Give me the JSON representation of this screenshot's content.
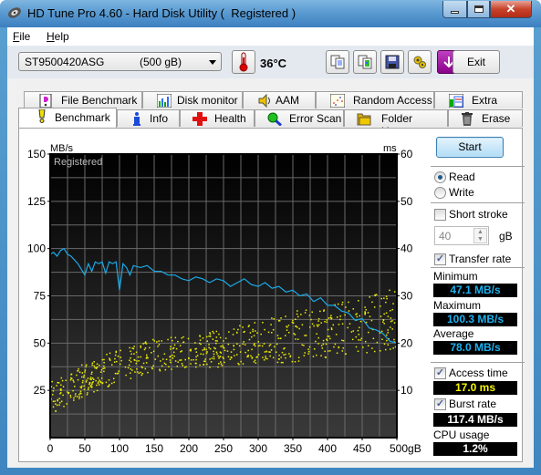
{
  "window": {
    "title": "HD Tune Pro 4.60 - Hard Disk Utility (  Registered )",
    "controls": {
      "minimize": "minimize",
      "maximize": "maximize",
      "close": "close"
    }
  },
  "menu": [
    {
      "label": "File",
      "accel": "F"
    },
    {
      "label": "Help",
      "accel": "H"
    }
  ],
  "toolbar": {
    "drive": {
      "name": "ST9500420ASG",
      "size": "(500 gB)"
    },
    "temperature": "36°C",
    "icons": [
      "thermometer-icon",
      "copy-text-icon",
      "copy-image-icon",
      "save-icon",
      "options-icon",
      "download-icon"
    ],
    "exit_label": "Exit"
  },
  "tabs": {
    "top_row": [
      {
        "label": "File Benchmark",
        "icon": "file-benchmark-icon"
      },
      {
        "label": "Disk monitor",
        "icon": "disk-monitor-icon"
      },
      {
        "label": "AAM",
        "icon": "speaker-icon"
      },
      {
        "label": "Random Access",
        "icon": "random-access-icon"
      },
      {
        "label": "Extra tests",
        "icon": "extra-tests-icon"
      }
    ],
    "bottom_row": [
      {
        "label": "Benchmark",
        "icon": "benchmark-icon",
        "active": true
      },
      {
        "label": "Info",
        "icon": "info-icon"
      },
      {
        "label": "Health",
        "icon": "health-icon"
      },
      {
        "label": "Error Scan",
        "icon": "error-scan-icon"
      },
      {
        "label": "Folder Usage",
        "icon": "folder-icon"
      },
      {
        "label": "Erase",
        "icon": "trash-icon"
      }
    ]
  },
  "controls": {
    "start_label": "Start",
    "read_label": "Read",
    "write_label": "Write",
    "mode_selected": "Read",
    "short_stroke_label": "Short stroke",
    "short_stroke_checked": false,
    "short_stroke_value": "40",
    "short_stroke_unit": "gB",
    "transfer_rate_label": "Transfer rate",
    "transfer_rate_checked": true,
    "access_time_label": "Access time",
    "access_time_checked": true,
    "burst_rate_label": "Burst rate",
    "burst_rate_checked": true
  },
  "results": {
    "minimum_label": "Minimum",
    "minimum": "47.1 MB/s",
    "maximum_label": "Maximum",
    "maximum": "100.3 MB/s",
    "average_label": "Average",
    "average": "78.0 MB/s",
    "access_time": "17.0 ms",
    "burst_rate": "117.4 MB/s",
    "cpu_usage_label": "CPU usage",
    "cpu_usage": "1.2%"
  },
  "colors": {
    "transfer_line": "#1aa9e8",
    "access_points": "#f0f000",
    "plot_bg_top": "#000000",
    "plot_bg_bottom": "#3a3a3a",
    "grid": "#6a6a6a",
    "readout_cyan": "#1ab2f0",
    "readout_yellow": "#f5f500"
  },
  "chart_data": {
    "type": "line",
    "watermark": "Registered",
    "xlabel": "gB",
    "ylabel_left": "MB/s",
    "ylabel_right": "ms",
    "xlim": [
      0,
      500
    ],
    "ylim_left": [
      0,
      150
    ],
    "ylim_right": [
      0,
      60
    ],
    "x_ticks": [
      "0",
      "50",
      "100",
      "150",
      "200",
      "250",
      "300",
      "350",
      "400",
      "450",
      "500gB"
    ],
    "y_left_ticks": [
      "25",
      "50",
      "75",
      "100",
      "125",
      "150"
    ],
    "y_right_ticks": [
      "10",
      "20",
      "30",
      "40",
      "50",
      "60"
    ],
    "grid": true,
    "series": [
      {
        "name": "Transfer rate",
        "axis": "left",
        "unit": "MB/s",
        "x": [
          0,
          5,
          10,
          15,
          20,
          25,
          30,
          40,
          50,
          55,
          60,
          65,
          70,
          75,
          80,
          85,
          90,
          95,
          100,
          105,
          110,
          115,
          120,
          130,
          140,
          150,
          160,
          170,
          180,
          190,
          200,
          210,
          220,
          230,
          240,
          250,
          260,
          270,
          280,
          290,
          300,
          310,
          320,
          330,
          340,
          350,
          360,
          370,
          380,
          390,
          400,
          410,
          420,
          430,
          440,
          450,
          460,
          470,
          480,
          490,
          500
        ],
        "values": [
          97,
          98,
          96,
          99,
          100,
          97,
          96,
          92,
          86,
          92,
          88,
          93,
          92,
          93,
          87,
          93,
          92,
          93,
          78,
          92,
          90,
          86,
          91,
          90,
          91,
          88,
          88,
          86,
          86,
          84,
          83,
          85,
          84,
          82,
          84,
          83,
          80,
          82,
          84,
          81,
          80,
          82,
          79,
          80,
          77,
          78,
          75,
          76,
          72,
          74,
          70,
          70,
          67,
          66,
          62,
          63,
          58,
          57,
          55,
          51,
          50
        ]
      },
      {
        "name": "Access time",
        "axis": "right",
        "unit": "ms",
        "type": "scatter",
        "description": "scattered points, roughly 5-12 ms near 0gB rising to 14-32 ms near 500gB",
        "trend_low_ms": [
          5,
          9,
          12,
          14,
          15,
          15,
          16,
          16,
          17,
          18,
          19
        ],
        "trend_high_ms": [
          12,
          16,
          19,
          21,
          22,
          23,
          25,
          27,
          28,
          30,
          32
        ],
        "trend_x": [
          0,
          50,
          100,
          150,
          200,
          250,
          300,
          350,
          400,
          450,
          500
        ],
        "average_ms": 17.0
      }
    ]
  }
}
